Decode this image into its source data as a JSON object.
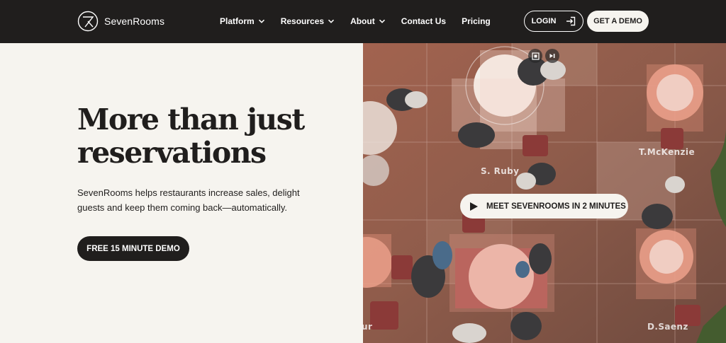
{
  "brand": {
    "name": "SevenRooms"
  },
  "nav": {
    "items": [
      {
        "label": "Platform",
        "dropdown": true
      },
      {
        "label": "Resources",
        "dropdown": true
      },
      {
        "label": "About",
        "dropdown": true
      },
      {
        "label": "Contact Us",
        "dropdown": false
      },
      {
        "label": "Pricing",
        "dropdown": false
      }
    ],
    "login_label": "LOGIN",
    "demo_label": "GET A DEMO"
  },
  "hero": {
    "title_line1": "More than just",
    "title_line2": "reservations",
    "subtitle": "SevenRooms helps restaurants increase sales, delight guests and keep them coming back—automatically.",
    "cta_label": "FREE 15 MINUTE DEMO"
  },
  "video": {
    "cta_label": "MEET SEVENROOMS IN 2 MINUTES",
    "hosts": [
      "S. Ruby",
      "T.McKenzie",
      "D.Saenz",
      "ur"
    ]
  },
  "colors": {
    "nav_bg": "#201e1d",
    "page_bg": "#f6f4ef",
    "overlay_accent": "#e8967f"
  }
}
